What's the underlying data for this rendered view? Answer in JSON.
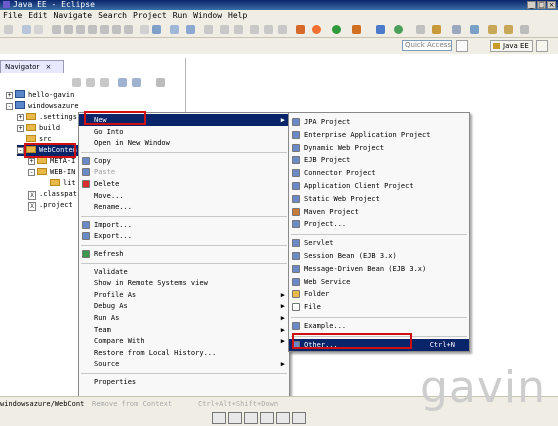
{
  "window": {
    "title": "Java EE - Eclipse"
  },
  "menubar": [
    "File",
    "Edit",
    "Navigate",
    "Search",
    "Project",
    "Run",
    "Window",
    "Help"
  ],
  "toolbar": {
    "quick_access_placeholder": "Quick Access",
    "perspective_label": "Java EE"
  },
  "navigator": {
    "tab_label": "Navigator",
    "tree": [
      {
        "label": "hello-gavin",
        "kind": "project",
        "expander": "+"
      },
      {
        "label": "windowsazure",
        "kind": "project",
        "expander": "-"
      },
      {
        "label": ".settings",
        "kind": "folder",
        "expander": "+"
      },
      {
        "label": "build",
        "kind": "folder",
        "expander": "+"
      },
      {
        "label": "src",
        "kind": "folder",
        "expander": ""
      },
      {
        "label": "WebConten",
        "kind": "folder",
        "expander": "-",
        "selected": true
      },
      {
        "label": "META-I",
        "kind": "folder",
        "expander": "+"
      },
      {
        "label": "WEB-IN",
        "kind": "folder",
        "expander": "-"
      },
      {
        "label": "lit",
        "kind": "folder",
        "expander": ""
      },
      {
        "label": ".classpat",
        "kind": "file",
        "expander": ""
      },
      {
        "label": ".project",
        "kind": "file",
        "expander": ""
      }
    ]
  },
  "context_menu": {
    "items": [
      {
        "label": "New",
        "submenu": true,
        "highlighted": true
      },
      {
        "label": "Go Into"
      },
      {
        "label": "Open in New Window"
      },
      {
        "sep": true
      },
      {
        "label": "Copy",
        "icon": "copy-icon"
      },
      {
        "label": "Paste",
        "disabled": true,
        "icon": "paste-icon"
      },
      {
        "label": "Delete",
        "icon": "delete-icon"
      },
      {
        "label": "Move..."
      },
      {
        "label": "Rename..."
      },
      {
        "sep": true
      },
      {
        "label": "Import...",
        "icon": "import-icon"
      },
      {
        "label": "Export...",
        "icon": "export-icon"
      },
      {
        "sep": true
      },
      {
        "label": "Refresh",
        "icon": "refresh-icon"
      },
      {
        "sep": true
      },
      {
        "label": "Validate"
      },
      {
        "label": "Show in Remote Systems view"
      },
      {
        "label": "Profile As",
        "submenu": true
      },
      {
        "label": "Debug As",
        "submenu": true
      },
      {
        "label": "Run As",
        "submenu": true
      },
      {
        "label": "Team",
        "submenu": true
      },
      {
        "label": "Compare With",
        "submenu": true
      },
      {
        "label": "Restore from Local History..."
      },
      {
        "label": "Source",
        "submenu": true
      },
      {
        "sep": true
      },
      {
        "label": "Properties"
      }
    ]
  },
  "submenu": {
    "items": [
      {
        "label": "JPA Project",
        "icon": "jpa-project-icon"
      },
      {
        "label": "Enterprise Application Project",
        "icon": "ear-project-icon"
      },
      {
        "label": "Dynamic Web Project",
        "icon": "web-project-icon"
      },
      {
        "label": "EJB Project",
        "icon": "ejb-project-icon"
      },
      {
        "label": "Connector Project",
        "icon": "connector-project-icon"
      },
      {
        "label": "Application Client Project",
        "icon": "client-project-icon"
      },
      {
        "label": "Static Web Project",
        "icon": "static-web-project-icon"
      },
      {
        "label": "Maven Project",
        "icon": "maven-project-icon"
      },
      {
        "label": "Project...",
        "icon": "project-icon"
      },
      {
        "sep": true
      },
      {
        "label": "Servlet",
        "icon": "servlet-icon"
      },
      {
        "label": "Session Bean (EJB 3.x)",
        "icon": "session-bean-icon"
      },
      {
        "label": "Message-Driven Bean (EJB 3.x)",
        "icon": "mdb-icon"
      },
      {
        "label": "Web Service",
        "icon": "web-service-icon"
      },
      {
        "label": "Folder",
        "icon": "folder-icon"
      },
      {
        "label": "File",
        "icon": "file-icon"
      },
      {
        "sep": true
      },
      {
        "label": "Example...",
        "icon": "example-icon"
      },
      {
        "sep": true
      },
      {
        "label": "Other...",
        "shortcut": "Ctrl+N",
        "highlighted": true,
        "icon": "other-icon"
      }
    ]
  },
  "status": {
    "path": "windowsazure/WebCont",
    "remove_from_context": "Remove from Context",
    "remove_shortcut": "Ctrl+Alt+Shift+Down"
  },
  "watermark": "gavin"
}
